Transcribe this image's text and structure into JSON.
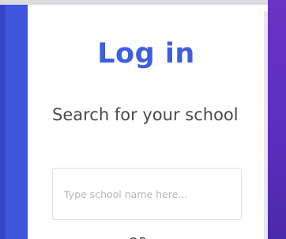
{
  "login": {
    "title": "Log in",
    "school_label": "Search for your school",
    "school_input": {
      "value": "",
      "placeholder": "Type school name here..."
    },
    "or_text": "OR"
  },
  "colors": {
    "accent_blue": "#3d5ee0",
    "left_panel": "#3f55dd",
    "right_panel": "#6a33c4"
  }
}
